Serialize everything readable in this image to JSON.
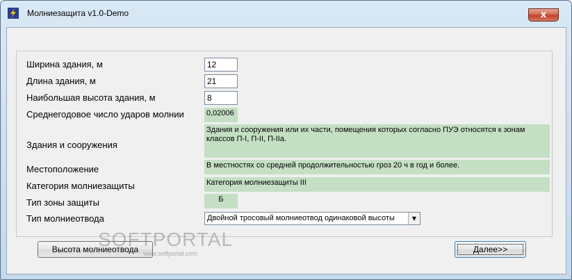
{
  "window": {
    "title": "Молниезащита v1.0-Demo",
    "close_label": "x"
  },
  "form": {
    "width_label": "Ширина здания, м",
    "width_value": "12",
    "length_label": "Длина здания, м",
    "length_value": "21",
    "height_label": "Наибольшая высота здания, м",
    "height_value": "8",
    "strikes_label": "Среднегодовое число ударов молнии",
    "strikes_value": "0,02006",
    "buildings_label": "Здания и сооружения",
    "buildings_value": "Здания и сооружения или их части, помещения которых согласно ПУЭ относятся к зонам классов П-I, П-II, П-IIa.",
    "location_label": "Местоположение",
    "location_value": "В местностях со средней продолжительностью гроз 20 ч в год и более.",
    "category_label": "Категория молниезащиты",
    "category_value": "Категория молниезащиты III",
    "zone_label": "Тип зоны защиты",
    "zone_value": "Б",
    "rod_label": "Тип молниеотвода",
    "rod_value": "Двойной тросовый молниеотвод одинаковой высоты"
  },
  "buttons": {
    "height": "Высота молниеотвода",
    "next": "Далее>>"
  },
  "watermark": {
    "brand": "SOFTPORTAL",
    "url": "www.softportal.com"
  }
}
